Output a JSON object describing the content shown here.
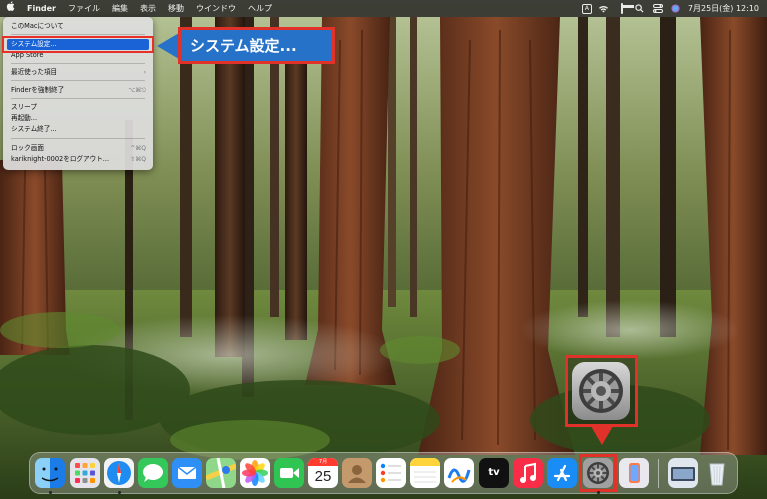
{
  "menubar": {
    "apple_icon": "apple-logo-icon",
    "app_name": "Finder",
    "items": [
      "ファイル",
      "編集",
      "表示",
      "移動",
      "ウインドウ",
      "ヘルプ"
    ],
    "input_indicator": "A",
    "clock": "7月25日(金)  12:10"
  },
  "apple_menu": {
    "items": [
      {
        "label": "このMacについて",
        "shortcut": ""
      },
      {
        "label": "システム設定...",
        "shortcut": "",
        "selected": true
      },
      {
        "label": "App Store",
        "shortcut": ""
      },
      {
        "label": "最近使った項目",
        "shortcut": "›"
      },
      {
        "label": "Finderを強制終了",
        "shortcut": "⌥⌘⎋"
      },
      {
        "label": "スリープ",
        "shortcut": ""
      },
      {
        "label": "再起動...",
        "shortcut": ""
      },
      {
        "label": "システム終了...",
        "shortcut": ""
      },
      {
        "label": "ロック画面",
        "shortcut": "^⌘Q"
      },
      {
        "label": "kariknight-0002をログアウト...",
        "shortcut": "⇧⌘Q"
      }
    ]
  },
  "callout": {
    "text": "システム設定..."
  },
  "dock": {
    "calendar": {
      "month": "7月",
      "day": "25"
    },
    "tv_label": "tv",
    "apps": [
      "finder-icon",
      "launchpad-icon",
      "safari-icon",
      "messages-icon",
      "mail-icon",
      "maps-icon",
      "photos-icon",
      "facetime-icon",
      "calendar-icon",
      "contacts-icon",
      "reminders-icon",
      "notes-icon",
      "freeform-icon",
      "apple-tv-icon",
      "music-icon",
      "app-store-icon",
      "system-settings-icon",
      "iphone-mirroring-icon",
      "downloads-folder-icon",
      "trash-icon"
    ]
  },
  "colors": {
    "highlight_red": "#e03228",
    "callout_blue": "#2672c9",
    "menu_selection": "#1a63d6"
  }
}
